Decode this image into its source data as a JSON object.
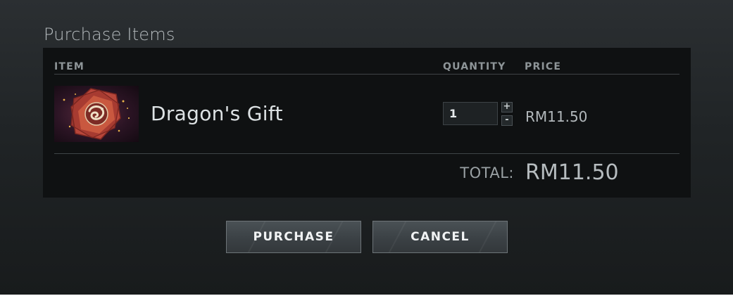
{
  "dialog": {
    "title": "Purchase Items"
  },
  "table": {
    "headers": {
      "item": "ITEM",
      "quantity": "QUANTITY",
      "price": "PRICE"
    },
    "rows": [
      {
        "name": "Dragon's Gift",
        "image": "dragon-gift-chest-icon",
        "quantity": "1",
        "price": "RM11.50"
      }
    ],
    "stepper": {
      "increment": "+",
      "decrement": "-"
    }
  },
  "total": {
    "label": "TOTAL:",
    "value": "RM11.50"
  },
  "actions": {
    "purchase": "PURCHASE",
    "cancel": "CANCEL"
  },
  "colors": {
    "background": "#202426",
    "panel": "#0f1112",
    "button": "#3b4145"
  }
}
